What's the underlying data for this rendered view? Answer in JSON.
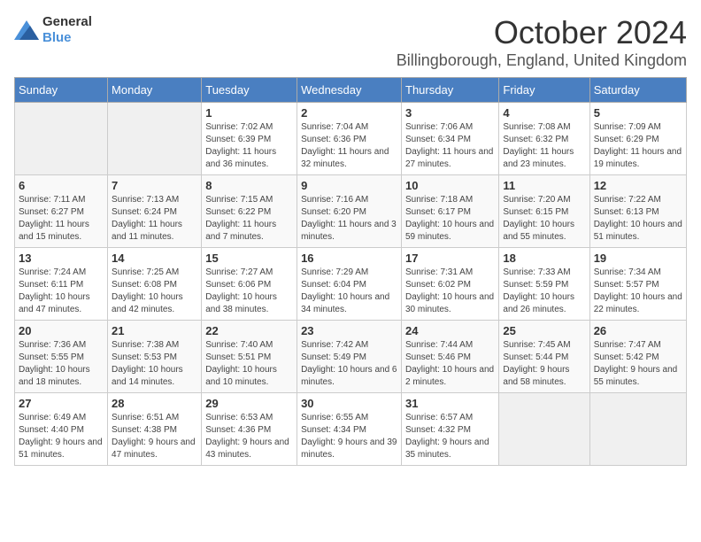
{
  "logo": {
    "text_general": "General",
    "text_blue": "Blue"
  },
  "header": {
    "month": "October 2024",
    "location": "Billingborough, England, United Kingdom"
  },
  "weekdays": [
    "Sunday",
    "Monday",
    "Tuesday",
    "Wednesday",
    "Thursday",
    "Friday",
    "Saturday"
  ],
  "weeks": [
    [
      {
        "day": "",
        "empty": true
      },
      {
        "day": "",
        "empty": true
      },
      {
        "day": "1",
        "sunrise": "Sunrise: 7:02 AM",
        "sunset": "Sunset: 6:39 PM",
        "daylight": "Daylight: 11 hours and 36 minutes."
      },
      {
        "day": "2",
        "sunrise": "Sunrise: 7:04 AM",
        "sunset": "Sunset: 6:36 PM",
        "daylight": "Daylight: 11 hours and 32 minutes."
      },
      {
        "day": "3",
        "sunrise": "Sunrise: 7:06 AM",
        "sunset": "Sunset: 6:34 PM",
        "daylight": "Daylight: 11 hours and 27 minutes."
      },
      {
        "day": "4",
        "sunrise": "Sunrise: 7:08 AM",
        "sunset": "Sunset: 6:32 PM",
        "daylight": "Daylight: 11 hours and 23 minutes."
      },
      {
        "day": "5",
        "sunrise": "Sunrise: 7:09 AM",
        "sunset": "Sunset: 6:29 PM",
        "daylight": "Daylight: 11 hours and 19 minutes."
      }
    ],
    [
      {
        "day": "6",
        "sunrise": "Sunrise: 7:11 AM",
        "sunset": "Sunset: 6:27 PM",
        "daylight": "Daylight: 11 hours and 15 minutes."
      },
      {
        "day": "7",
        "sunrise": "Sunrise: 7:13 AM",
        "sunset": "Sunset: 6:24 PM",
        "daylight": "Daylight: 11 hours and 11 minutes."
      },
      {
        "day": "8",
        "sunrise": "Sunrise: 7:15 AM",
        "sunset": "Sunset: 6:22 PM",
        "daylight": "Daylight: 11 hours and 7 minutes."
      },
      {
        "day": "9",
        "sunrise": "Sunrise: 7:16 AM",
        "sunset": "Sunset: 6:20 PM",
        "daylight": "Daylight: 11 hours and 3 minutes."
      },
      {
        "day": "10",
        "sunrise": "Sunrise: 7:18 AM",
        "sunset": "Sunset: 6:17 PM",
        "daylight": "Daylight: 10 hours and 59 minutes."
      },
      {
        "day": "11",
        "sunrise": "Sunrise: 7:20 AM",
        "sunset": "Sunset: 6:15 PM",
        "daylight": "Daylight: 10 hours and 55 minutes."
      },
      {
        "day": "12",
        "sunrise": "Sunrise: 7:22 AM",
        "sunset": "Sunset: 6:13 PM",
        "daylight": "Daylight: 10 hours and 51 minutes."
      }
    ],
    [
      {
        "day": "13",
        "sunrise": "Sunrise: 7:24 AM",
        "sunset": "Sunset: 6:11 PM",
        "daylight": "Daylight: 10 hours and 47 minutes."
      },
      {
        "day": "14",
        "sunrise": "Sunrise: 7:25 AM",
        "sunset": "Sunset: 6:08 PM",
        "daylight": "Daylight: 10 hours and 42 minutes."
      },
      {
        "day": "15",
        "sunrise": "Sunrise: 7:27 AM",
        "sunset": "Sunset: 6:06 PM",
        "daylight": "Daylight: 10 hours and 38 minutes."
      },
      {
        "day": "16",
        "sunrise": "Sunrise: 7:29 AM",
        "sunset": "Sunset: 6:04 PM",
        "daylight": "Daylight: 10 hours and 34 minutes."
      },
      {
        "day": "17",
        "sunrise": "Sunrise: 7:31 AM",
        "sunset": "Sunset: 6:02 PM",
        "daylight": "Daylight: 10 hours and 30 minutes."
      },
      {
        "day": "18",
        "sunrise": "Sunrise: 7:33 AM",
        "sunset": "Sunset: 5:59 PM",
        "daylight": "Daylight: 10 hours and 26 minutes."
      },
      {
        "day": "19",
        "sunrise": "Sunrise: 7:34 AM",
        "sunset": "Sunset: 5:57 PM",
        "daylight": "Daylight: 10 hours and 22 minutes."
      }
    ],
    [
      {
        "day": "20",
        "sunrise": "Sunrise: 7:36 AM",
        "sunset": "Sunset: 5:55 PM",
        "daylight": "Daylight: 10 hours and 18 minutes."
      },
      {
        "day": "21",
        "sunrise": "Sunrise: 7:38 AM",
        "sunset": "Sunset: 5:53 PM",
        "daylight": "Daylight: 10 hours and 14 minutes."
      },
      {
        "day": "22",
        "sunrise": "Sunrise: 7:40 AM",
        "sunset": "Sunset: 5:51 PM",
        "daylight": "Daylight: 10 hours and 10 minutes."
      },
      {
        "day": "23",
        "sunrise": "Sunrise: 7:42 AM",
        "sunset": "Sunset: 5:49 PM",
        "daylight": "Daylight: 10 hours and 6 minutes."
      },
      {
        "day": "24",
        "sunrise": "Sunrise: 7:44 AM",
        "sunset": "Sunset: 5:46 PM",
        "daylight": "Daylight: 10 hours and 2 minutes."
      },
      {
        "day": "25",
        "sunrise": "Sunrise: 7:45 AM",
        "sunset": "Sunset: 5:44 PM",
        "daylight": "Daylight: 9 hours and 58 minutes."
      },
      {
        "day": "26",
        "sunrise": "Sunrise: 7:47 AM",
        "sunset": "Sunset: 5:42 PM",
        "daylight": "Daylight: 9 hours and 55 minutes."
      }
    ],
    [
      {
        "day": "27",
        "sunrise": "Sunrise: 6:49 AM",
        "sunset": "Sunset: 4:40 PM",
        "daylight": "Daylight: 9 hours and 51 minutes."
      },
      {
        "day": "28",
        "sunrise": "Sunrise: 6:51 AM",
        "sunset": "Sunset: 4:38 PM",
        "daylight": "Daylight: 9 hours and 47 minutes."
      },
      {
        "day": "29",
        "sunrise": "Sunrise: 6:53 AM",
        "sunset": "Sunset: 4:36 PM",
        "daylight": "Daylight: 9 hours and 43 minutes."
      },
      {
        "day": "30",
        "sunrise": "Sunrise: 6:55 AM",
        "sunset": "Sunset: 4:34 PM",
        "daylight": "Daylight: 9 hours and 39 minutes."
      },
      {
        "day": "31",
        "sunrise": "Sunrise: 6:57 AM",
        "sunset": "Sunset: 4:32 PM",
        "daylight": "Daylight: 9 hours and 35 minutes."
      },
      {
        "day": "",
        "empty": true
      },
      {
        "day": "",
        "empty": true
      }
    ]
  ]
}
